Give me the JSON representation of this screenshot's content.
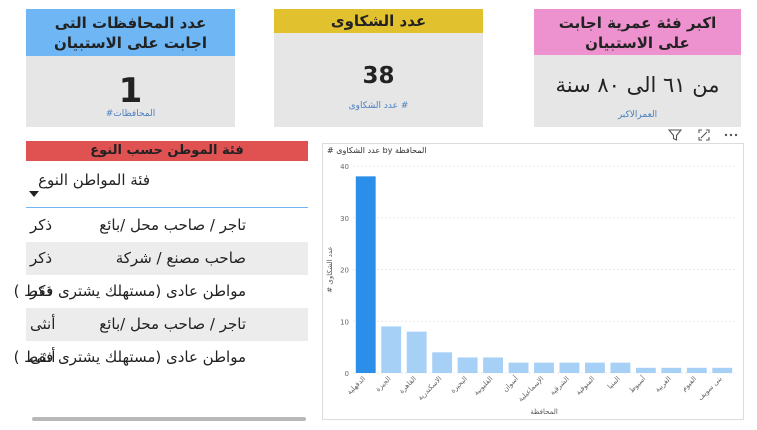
{
  "cards": {
    "right": {
      "title": "اكبر فئة عمرية اجابت على الاستبيان",
      "value": "من ٦١ الى ٨٠ سنة",
      "subtitle": "العمرالاكبر",
      "color": "#ee92cf"
    },
    "middle": {
      "title": "عدد الشكاوى",
      "value": "38",
      "subtitle": "# عدد الشكاوى",
      "color": "#e2c12f"
    },
    "left": {
      "title": "عدد المحافظات التى اجابت على الاستبيان",
      "value": "1",
      "subtitle": "المحافظات#",
      "color": "#6fb6f5"
    }
  },
  "table": {
    "title": "فئة الموطن حسب النوع",
    "title_color": "#e05151",
    "header_label": "فئة المواطن النوع",
    "rows": [
      {
        "type": "تاجر / صاحب محل /بائع",
        "gender": "ذكر"
      },
      {
        "type": "صاحب مصنع / شركة",
        "gender": "ذكر"
      },
      {
        "type": "مواطن عادى (مستهلك يشترى فقط )",
        "gender": "ذكر"
      },
      {
        "type": "تاجر / صاحب محل /بائع",
        "gender": "أنثى"
      },
      {
        "type": "مواطن عادى (مستهلك يشترى فقط )",
        "gender": "أنثى"
      }
    ]
  },
  "toolbar": {
    "icons": [
      "filter-icon",
      "focus-mode-icon",
      "more-options-icon"
    ]
  },
  "chart_data": {
    "type": "bar",
    "title": "# عدد الشكاوى by المحافظة",
    "xlabel": "المحافظة",
    "ylabel": "# عدد الشكاوى",
    "ylim": [
      0,
      40
    ],
    "yticks": [
      0,
      10,
      20,
      30,
      40
    ],
    "grid": true,
    "categories": [
      "الدقهلية",
      "الجيزة",
      "القاهرة",
      "الاسكندرية",
      "البحيرة",
      "القليوبية",
      "أسوان",
      "الإسماعيلية",
      "الشرقية",
      "المنوفية",
      "المنيا",
      "أسيوط",
      "الغربية",
      "الفيوم",
      "بنى سويف"
    ],
    "values": [
      38,
      9,
      8,
      4,
      3,
      3,
      2,
      2,
      2,
      2,
      2,
      1,
      1,
      1,
      1
    ],
    "highlight_index": 0,
    "highlight_color": "#2b8ee8",
    "bar_color": "#a7d0f7"
  }
}
